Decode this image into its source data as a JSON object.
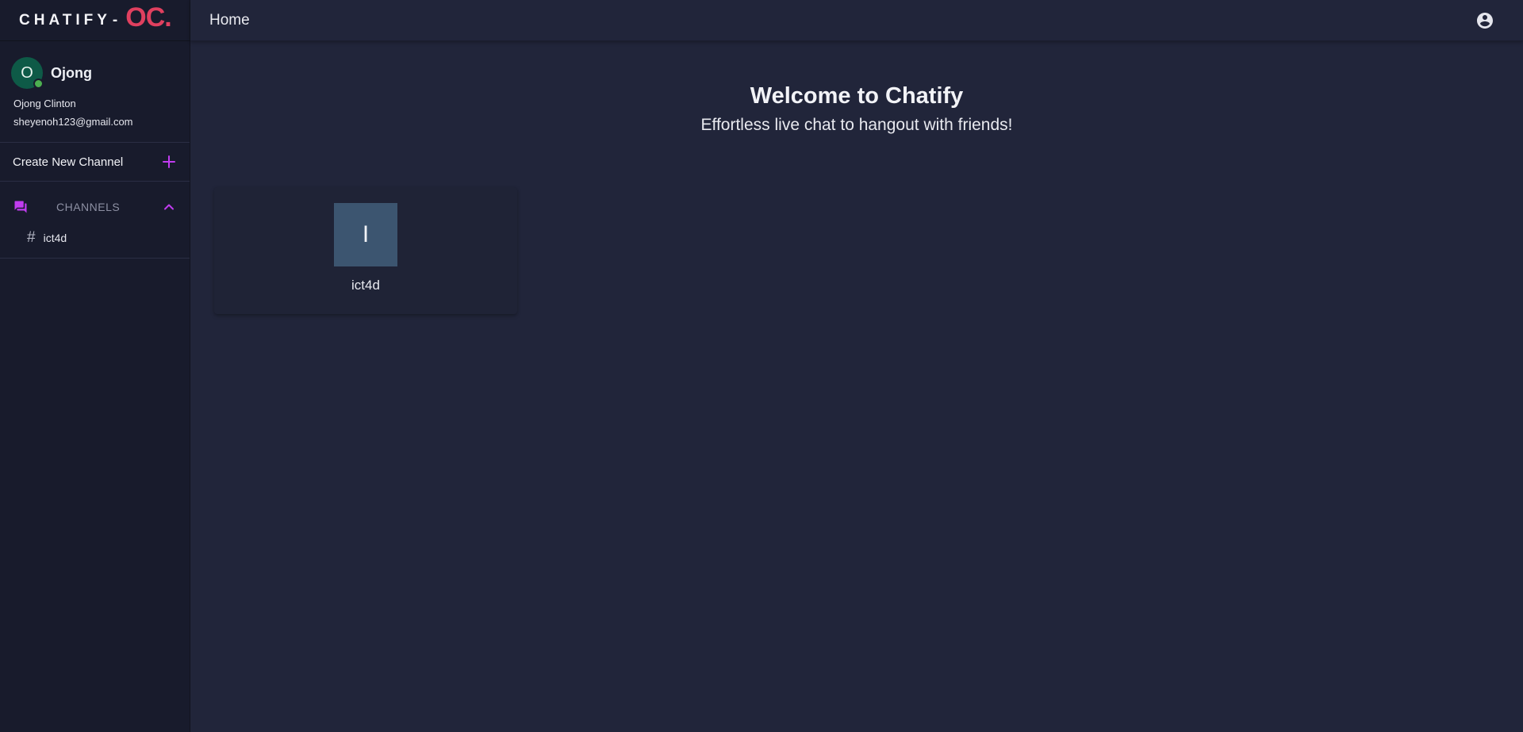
{
  "brand": {
    "name": "CHATIFY",
    "separator": "-",
    "logo": "OC."
  },
  "profile": {
    "avatar_initial": "O",
    "short_name": "Ojong",
    "full_name": "Ojong Clinton",
    "email": "sheyenoh123@gmail.com",
    "status": "online"
  },
  "sidebar": {
    "create_channel_label": "Create New Channel",
    "channels_title": "CHANNELS",
    "channels": [
      {
        "name": "ict4d",
        "icon": "hash-icon"
      }
    ]
  },
  "topbar": {
    "title": "Home",
    "account_icon": "account-circle-icon"
  },
  "main": {
    "welcome_title": "Welcome to Chatify",
    "welcome_subtitle": "Effortless live chat to hangout with friends!",
    "cards": [
      {
        "initial": "I",
        "name": "ict4d"
      }
    ]
  },
  "colors": {
    "accent": "#c13cf0",
    "logo": "#e0405f",
    "sidebar_bg": "#181b2c",
    "main_bg": "#21253a",
    "card_thumb": "#3c5570",
    "online": "#4caf50"
  }
}
